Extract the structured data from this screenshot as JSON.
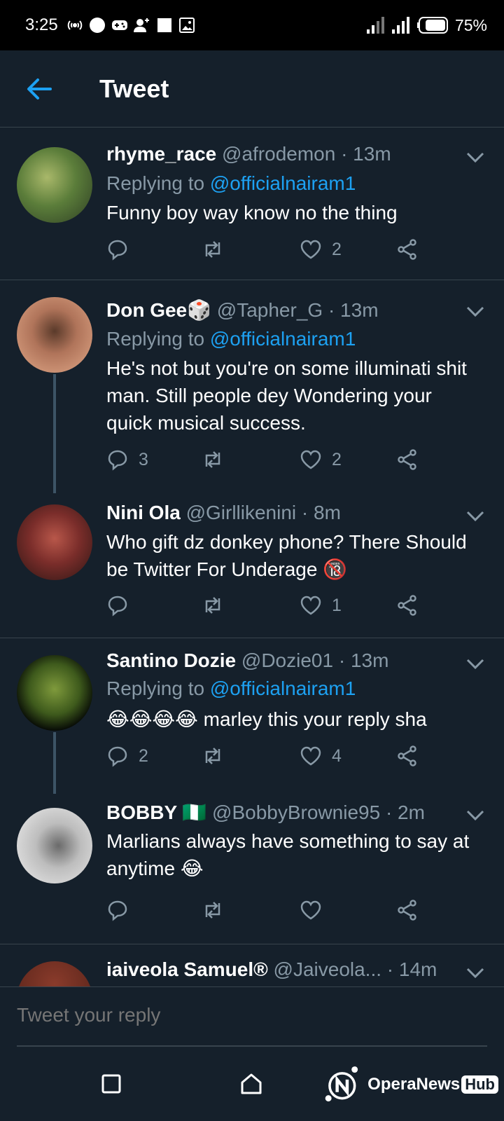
{
  "status_bar": {
    "time": "3:25",
    "battery_percent": "75%",
    "icons_left": [
      "hotspot-icon",
      "dot-icon",
      "gamepad-icon",
      "add-user-icon",
      "square-icon",
      "image-icon"
    ],
    "icons_right": [
      "signal-icon",
      "signal-icon",
      "battery-icon"
    ]
  },
  "header": {
    "title": "Tweet",
    "back_icon": "back-arrow-icon"
  },
  "colors": {
    "background": "#15202b",
    "accent": "#1da1f2",
    "muted": "#8899a6",
    "divider": "#38444d"
  },
  "tweets": [
    {
      "name": "rhyme_race",
      "meta": "@afrodemon · 13m",
      "replying_prefix": "Replying to",
      "replying_to": "@officialnairam1",
      "text": "Funny boy way know no the thing",
      "replies": "",
      "likes": "2"
    },
    {
      "name": "Don Gee🎲",
      "meta": "@Tapher_G · 13m",
      "replying_prefix": "Replying to",
      "replying_to": "@officialnairam1",
      "text": "He's not but you're on some illuminati shit man. Still people dey Wondering your quick musical success.",
      "replies": "3",
      "likes": "2"
    },
    {
      "name": "Nini Ola",
      "meta": "@Girllikenini · 8m",
      "text": "Who gift dz donkey phone?  There Should be Twitter For Underage 🔞",
      "replies": "",
      "likes": "1"
    },
    {
      "name": "Santino Dozie",
      "meta": "@Dozie01 · 13m",
      "replying_prefix": "Replying to",
      "replying_to": "@officialnairam1",
      "text": "😂😂😂😂 marley this your reply sha",
      "replies": "2",
      "likes": "4"
    },
    {
      "name": "BOBBY 🇳🇬",
      "meta": "@BobbyBrownie95 · 2m",
      "text": "Marlians always have something to say at anytime 😂",
      "replies": "",
      "likes": ""
    },
    {
      "name": "iaiveola Samuel®",
      "meta": "@Jaiveola... · 14m"
    }
  ],
  "reply_box": {
    "placeholder": "Tweet your reply"
  },
  "nav": {
    "recents_icon": "square-icon",
    "home_icon": "home-icon",
    "back_icon": "triangle-back-icon"
  },
  "watermark": {
    "text": "OperaNews",
    "hub": "Hub"
  }
}
